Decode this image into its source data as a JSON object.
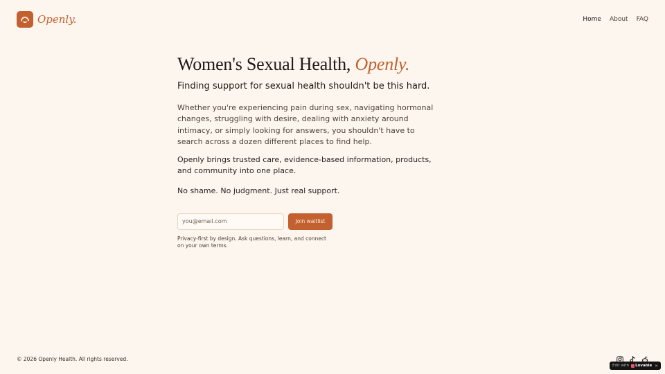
{
  "brand": {
    "name": "Openly.",
    "logo_icon": "arch-smile-icon",
    "accent": "#c2602f"
  },
  "nav": {
    "items": [
      {
        "label": "Home",
        "active": true
      },
      {
        "label": "About",
        "active": false
      },
      {
        "label": "FAQ",
        "active": false
      }
    ]
  },
  "hero": {
    "headline_main": "Women's Sexual Health, ",
    "headline_accent": "Openly.",
    "subhead": "Finding support for sexual health shouldn't be this hard.",
    "paragraph1": "Whether you're experiencing pain during sex, navigating hormonal changes, struggling with desire, dealing with anxiety around intimacy, or simply looking for answers, you shouldn't have to search across a dozen different places to find help.",
    "paragraph2": "Openly brings trusted care, evidence-based information, products, and community into one place.",
    "paragraph3": "No shame. No judgment. Just real support."
  },
  "waitlist": {
    "email_placeholder": "you@email.com",
    "email_value": "",
    "button_label": "Join waitlist",
    "privacy_note": "Privacy-first by design. Ask questions, learn, and connect on your own terms."
  },
  "footer": {
    "copyright": "© 2026 Openly Health. All rights reserved.",
    "socials": [
      "instagram-icon",
      "tiktok-icon",
      "reddit-icon"
    ]
  },
  "lovable_badge": {
    "prefix": "Edit with",
    "brand": "Lovable",
    "close": "×"
  }
}
